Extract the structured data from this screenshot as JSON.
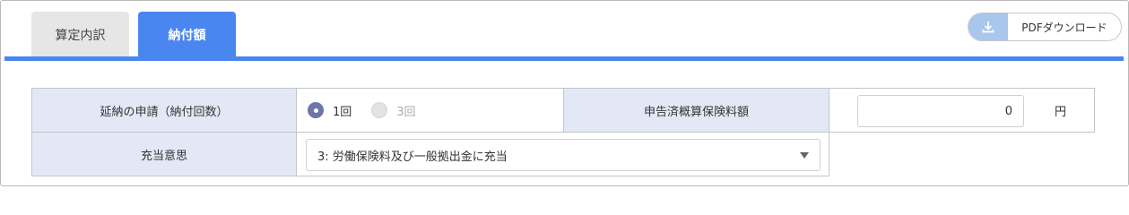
{
  "tabs": {
    "inactive_label": "算定内訳",
    "active_label": "納付額"
  },
  "pdf_button": {
    "label": "PDFダウンロード",
    "icon": "download-icon"
  },
  "colors": {
    "accent": "#4a86f0",
    "header_bg": "#e2e8f6",
    "radio_on": "#6b77a8"
  },
  "form": {
    "installment": {
      "label": "延納の申請（納付回数）",
      "options": [
        {
          "label": "1回",
          "selected": true
        },
        {
          "label": "3回",
          "selected": false
        }
      ]
    },
    "declared_premium": {
      "label": "申告済概算保険料額",
      "value": "0",
      "unit": "円"
    },
    "allocation": {
      "label": "充当意思",
      "selected": "3: 労働保険料及び一般拠出金に充当"
    }
  }
}
